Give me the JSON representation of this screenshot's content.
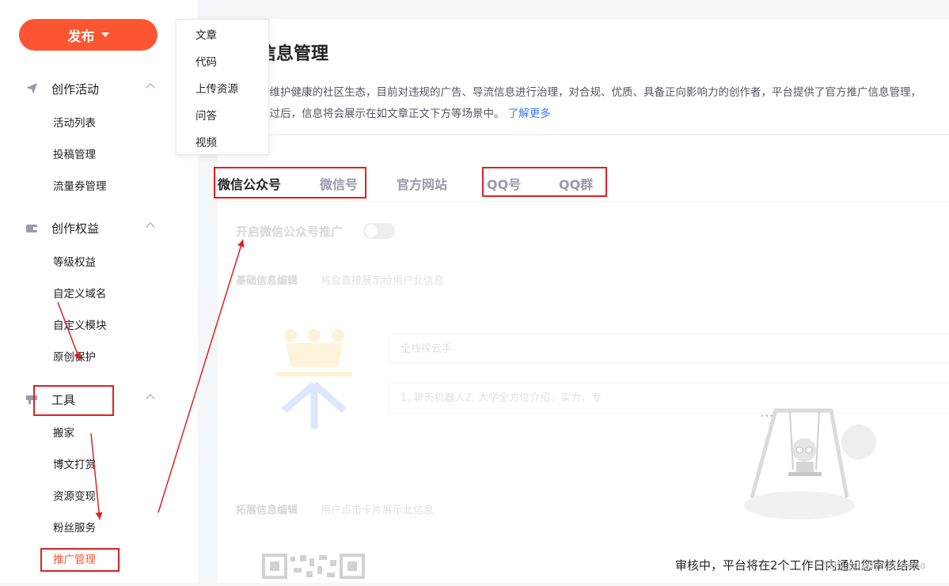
{
  "sidebar": {
    "publish_label": "发布",
    "groups": [
      {
        "label": "创作活动",
        "icon": "paper-plane-icon",
        "items": [
          "活动列表",
          "投稿管理",
          "流量券管理"
        ]
      },
      {
        "label": "创作权益",
        "icon": "wallet-icon",
        "items": [
          "等级权益",
          "自定义域名",
          "自定义模块",
          "原创保护"
        ]
      },
      {
        "label": "工具",
        "icon": "tool-icon",
        "items": [
          "搬家",
          "博文打赏",
          "资源变现",
          "粉丝服务",
          "推广管理"
        ]
      }
    ]
  },
  "publish_menu": [
    "文章",
    "代码",
    "上传资源",
    "问答",
    "视频"
  ],
  "main": {
    "title": "信息管理",
    "desc_line1": "和维护健康的社区生态，目前对违规的广告、导流信息进行治理，对合规、优质、具备正向影响力的创作者，平台提供了官方推广信息管理，",
    "desc_line2": "通过后，信息将会展示在如文章正文下方等场景中。",
    "learn_more": "了解更多",
    "tabs": [
      "微信公众号",
      "微信号",
      "官方网站",
      "QQ号",
      "QQ群"
    ],
    "active_tab": "微信公众号",
    "switch_label": "开启微信公众号推广",
    "basic_section": {
      "title": "基础信息编辑",
      "subtitle": "将会直接展示给用户此信息"
    },
    "field_name_value": "全栈探云手",
    "field_desc_value": "1. 聊天机器人2. 大学全方位介绍、实力、专",
    "ext_section": {
      "title": "拓展信息编辑",
      "subtitle": "用户点击卡片展示此信息"
    },
    "status_text": "审核中，平台将在2个工作日内通知您审核结果"
  },
  "watermark": "CSDN @ladymorgana",
  "colors": {
    "brand": "#fc5531",
    "link": "#3a7af2",
    "annotation": "#e02020"
  }
}
